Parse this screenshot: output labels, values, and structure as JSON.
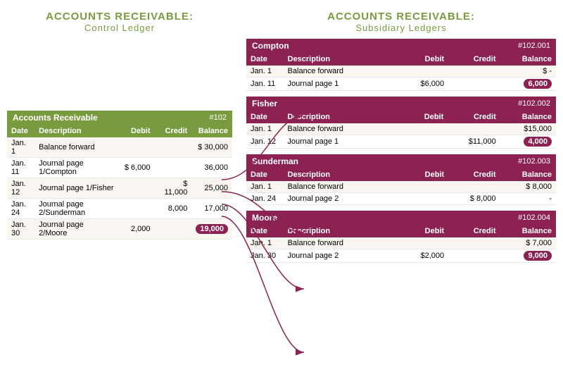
{
  "leftTitle": {
    "line1": "ACCOUNTS RECEIVABLE:",
    "line2": "Control Ledger"
  },
  "rightTitle": {
    "line1": "ACCOUNTS RECEIVABLE:",
    "line2": "Subsidiary Ledgers"
  },
  "controlLedger": {
    "title": "Accounts Receivable",
    "accountNum": "#102",
    "headers": [
      "Date",
      "Description",
      "Debit",
      "Credit",
      "Balance"
    ],
    "rows": [
      {
        "date": "Jan. 1",
        "desc": "Balance forward",
        "debit": "",
        "credit": "",
        "balance": "$ 30,000"
      },
      {
        "date": "Jan. 11",
        "desc": "Journal page 1/Compton",
        "debit": "$ 6,000",
        "credit": "",
        "balance": "36,000"
      },
      {
        "date": "Jan. 12",
        "desc": "Journal page 1/Fisher",
        "debit": "",
        "credit": "$ 11,000",
        "balance": "25,000"
      },
      {
        "date": "Jan. 24",
        "desc": "Journal page 2/Sunderman",
        "debit": "",
        "credit": "8,000",
        "balance": "17,000"
      },
      {
        "date": "Jan. 30",
        "desc": "Journal page 2/Moore",
        "debit": "2,000",
        "credit": "",
        "balance": "19,000",
        "highlight": true
      }
    ]
  },
  "subsidiaryLedgers": [
    {
      "name": "Compton",
      "accountNum": "#102.001",
      "headers": [
        "Date",
        "Description",
        "Debit",
        "Credit",
        "Balance"
      ],
      "rows": [
        {
          "date": "Jan. 1",
          "desc": "Balance forward",
          "debit": "",
          "credit": "",
          "balance": "$     -"
        },
        {
          "date": "Jan. 11",
          "desc": "Journal page 1",
          "debit": "$6,000",
          "credit": "",
          "balance": "6,000",
          "highlight": true
        }
      ]
    },
    {
      "name": "Fisher",
      "accountNum": "#102.002",
      "headers": [
        "Date",
        "Description",
        "Debit",
        "Credit",
        "Balance"
      ],
      "rows": [
        {
          "date": "Jan. 1",
          "desc": "Balance forward",
          "debit": "",
          "credit": "",
          "balance": "$15,000"
        },
        {
          "date": "Jan. 12",
          "desc": "Journal page 1",
          "debit": "",
          "credit": "$11,000",
          "balance": "4,000",
          "highlight": true
        }
      ]
    },
    {
      "name": "Sunderman",
      "accountNum": "#102.003",
      "headers": [
        "Date",
        "Description",
        "Debit",
        "Credit",
        "Balance"
      ],
      "rows": [
        {
          "date": "Jan. 1",
          "desc": "Balance forward",
          "debit": "",
          "credit": "",
          "balance": "$ 8,000"
        },
        {
          "date": "Jan. 24",
          "desc": "Journal page 2",
          "debit": "",
          "credit": "$ 8,000",
          "balance": "-"
        }
      ]
    },
    {
      "name": "Moore",
      "accountNum": "#102.004",
      "headers": [
        "Date",
        "Description",
        "Debit",
        "Credit",
        "Balance"
      ],
      "rows": [
        {
          "date": "Jan. 1",
          "desc": "Balance forward",
          "debit": "",
          "credit": "",
          "balance": "$ 7,000"
        },
        {
          "date": "Jan. 30",
          "desc": "Journal page 2",
          "debit": "$2,000",
          "credit": "",
          "balance": "9,000",
          "highlight": true
        }
      ]
    }
  ]
}
